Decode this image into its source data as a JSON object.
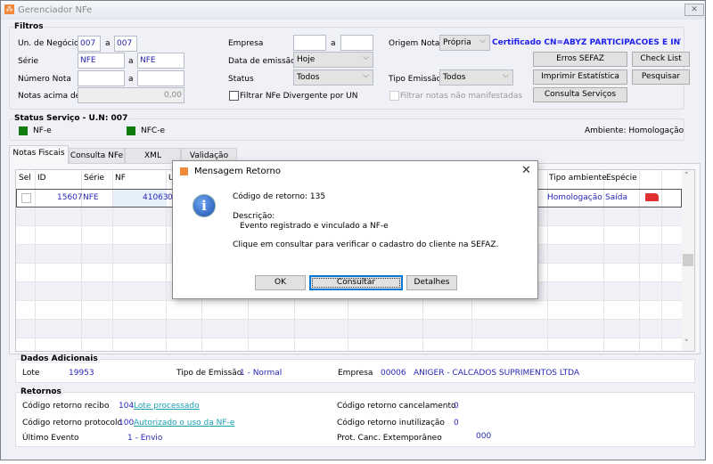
{
  "window": {
    "title": "Gerenciador NFe",
    "close_icon": "close-icon"
  },
  "filtros": {
    "title": "Filtros",
    "un_negocio": {
      "label": "Un. de Negócio",
      "from": "007",
      "sep": "a",
      "to": "007"
    },
    "serie": {
      "label": "Série",
      "from": "NFE",
      "sep": "a",
      "to": "NFE"
    },
    "numero_nota": {
      "label": "Número Nota",
      "from": "",
      "sep": "a",
      "to": ""
    },
    "notas_acima": {
      "label": "Notas acima de",
      "value": "0,00"
    },
    "empresa": {
      "label": "Empresa",
      "from": "",
      "sep": "a",
      "to": ""
    },
    "data_emissao": {
      "label": "Data de emissão",
      "value": "Hoje"
    },
    "status": {
      "label": "Status",
      "value": "Todos"
    },
    "filtrar_divergente": {
      "label": "Filtrar NFe Divergente por UN",
      "checked": false
    },
    "origem_nota": {
      "label": "Origem Nota",
      "value": "Própria"
    },
    "certificado": "Certificado CN=ABYZ PARTICIPACOES E INVEST",
    "tipo_emissao": {
      "label": "Tipo Emissão",
      "value": "Todos"
    },
    "filtrar_nao_manifestadas": {
      "label": "Filtrar notas não manifestadas",
      "checked": false
    },
    "buttons": {
      "erros_sefaz": "Erros SEFAZ",
      "check_list": "Check List",
      "imprimir": "Imprimir Estatística",
      "pesquisar": "Pesquisar",
      "consulta_servicos": "Consulta Serviços"
    }
  },
  "status_servico": {
    "title": "Status Serviço - U.N: 007",
    "nfe": "NF-e",
    "nfce": "NFC-e",
    "ambiente": "Ambiente: Homologação",
    "ok_color": "#107c10"
  },
  "tabs": [
    "Notas Fiscais",
    "Consulta NFe",
    "XML",
    "Validação XML"
  ],
  "grid": {
    "headers": [
      "Sel",
      "ID",
      "Série",
      "NF",
      "U",
      "Tipo ambiente",
      "Espécie"
    ],
    "rows": [
      {
        "id": "15607",
        "serie": "NFE",
        "nf": "41063",
        "u": "00",
        "tipo_ambiente": "Homologação",
        "especie": "Saída",
        "icon": "truck-icon"
      }
    ]
  },
  "dados_adicionais": {
    "title": "Dados Adicionais",
    "lote_label": "Lote",
    "lote": "19953",
    "tipo_emissao_label": "Tipo de Emissão",
    "tipo_emissao": "1 - Normal",
    "empresa_label": "Empresa",
    "empresa_code": "00006",
    "empresa_name": "ANIGER - CALCADOS SUPRIMENTOS LTDA"
  },
  "retornos": {
    "title": "Retornos",
    "recibo_label": "Código retorno recibo",
    "recibo_code": "104",
    "recibo_text": "Lote processado",
    "protocolo_label": "Código retorno protocolo",
    "protocolo_code": "100",
    "protocolo_text": "Autorizado o uso da NF-e",
    "ultimo_evento_label": "Último Evento",
    "ultimo_evento": "1 - Envio",
    "cancelamento_label": "Código retorno cancelamento",
    "cancelamento": "0",
    "inutilizacao_label": "Código retorno inutilização",
    "inutilizacao": "0",
    "prot_canc_label": "Prot. Canc. Extemporâneo",
    "prot_canc": "000"
  },
  "dialog": {
    "title": "Mensagem Retorno",
    "codigo": "Código de retorno: 135",
    "descricao_label": "Descrição:",
    "descricao": "Evento registrado e vinculado a NF-e",
    "mensagem": "Clique em consultar para verificar o cadastro do cliente na SEFAZ.",
    "ok": "OK",
    "consultar": "Consultar",
    "detalhes": "Detalhes"
  }
}
